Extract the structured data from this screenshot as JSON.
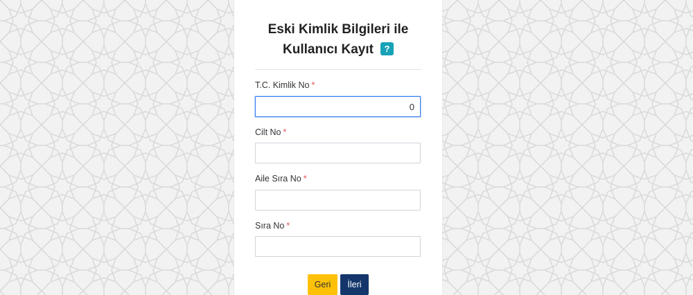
{
  "page": {
    "title_line1": "Eski Kimlik Bilgileri ile",
    "title_line2": "Kullanıcı Kayıt",
    "help_icon": "?"
  },
  "form": {
    "required_mark": "*",
    "fields": [
      {
        "label": "T.C. Kimlik No",
        "value": "0",
        "focused": true
      },
      {
        "label": "Cilt No",
        "value": ""
      },
      {
        "label": "Aile Sıra No",
        "value": ""
      },
      {
        "label": "Sıra No",
        "value": ""
      }
    ]
  },
  "buttons": {
    "back_label": "Geri",
    "next_label": "İleri"
  },
  "colors": {
    "help_icon": "#17a2b8",
    "back_button": "#ffc107",
    "next_button": "#14366b",
    "required": "#e0524f",
    "focus_border": "#3b82f0"
  },
  "icons": {
    "help": "question-mark-icon"
  }
}
